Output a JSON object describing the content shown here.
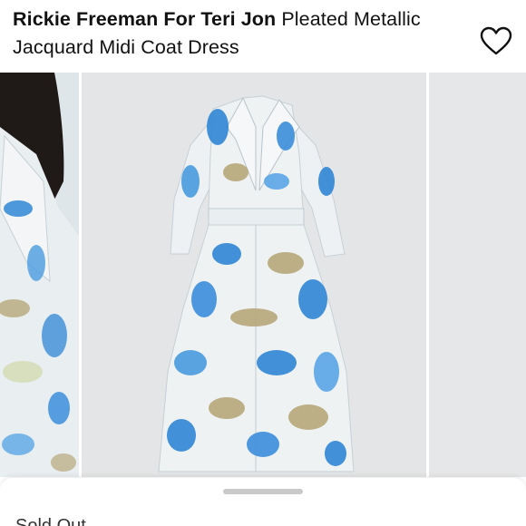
{
  "listing": {
    "brand": "Rickie Freeman For Teri Jon",
    "product_title": "Pleated Metallic Jacquard Midi Coat Dress",
    "status": "Sold Out"
  },
  "icons": {
    "like": "heart-icon"
  },
  "gallery": {
    "slides": [
      "previous-photo",
      "main-photo",
      "next-photo"
    ]
  },
  "colors": {
    "print_blue": "#2f86d6",
    "print_gold": "#b7a77a",
    "fabric_base": "#eef2f3",
    "background": "#e4e5e6"
  }
}
